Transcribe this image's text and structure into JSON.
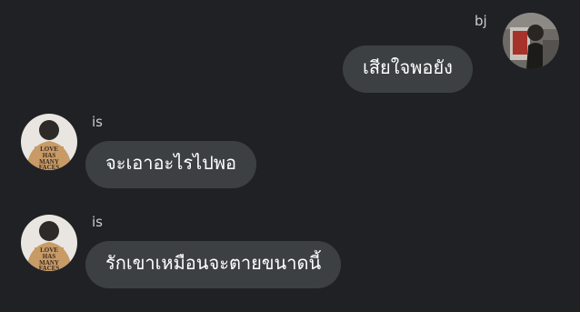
{
  "conversation": {
    "messages": [
      {
        "sender": "bj",
        "side": "right",
        "text": "เสียใจพอยัง",
        "avatar_icon": "person-with-painting-avatar"
      },
      {
        "sender": "is",
        "side": "left",
        "text": "จะเอาอะไรไปพอ",
        "avatar_icon": "person-love-has-many-faces-shirt-avatar",
        "shirt_text": "LOVE HAS MANY FACES"
      },
      {
        "sender": "is",
        "side": "left",
        "text": "รักเขาเหมือนจะตายขนาดนี้",
        "avatar_icon": "person-love-has-many-faces-shirt-avatar",
        "shirt_text": "LOVE HAS MANY FACES"
      }
    ]
  },
  "colors": {
    "background": "#202124",
    "bubble": "#3c4043",
    "text": "#ffffff",
    "name": "#c9cdd2"
  }
}
